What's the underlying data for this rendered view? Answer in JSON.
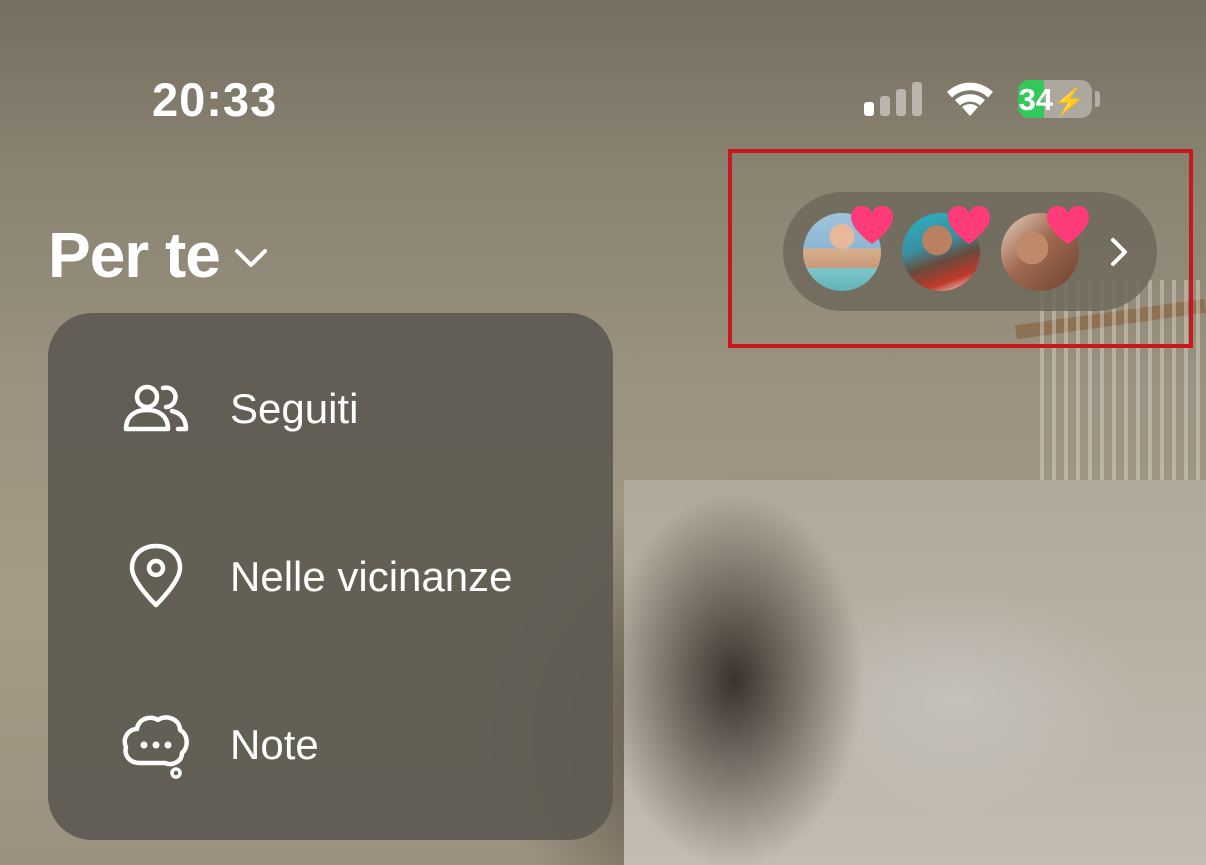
{
  "status_bar": {
    "time": "20:33",
    "battery_level": "34",
    "battery_color": "#34c759"
  },
  "header": {
    "feed_title": "Per te",
    "chevron_icon": "chevron-down-icon"
  },
  "menu": {
    "items": [
      {
        "label": "Seguiti",
        "icon": "people-icon"
      },
      {
        "label": "Nelle vicinanze",
        "icon": "location-pin-icon"
      },
      {
        "label": "Note",
        "icon": "chat-bubble-icon"
      }
    ]
  },
  "live_pill": {
    "avatars": [
      {
        "icon": "avatar-1",
        "badge": "heart-icon"
      },
      {
        "icon": "avatar-2",
        "badge": "heart-icon"
      },
      {
        "icon": "avatar-3",
        "badge": "heart-icon"
      }
    ],
    "arrow": "chevron-right-icon",
    "highlight_color": "#c9181b",
    "heart_color": "#ff3b7a"
  }
}
